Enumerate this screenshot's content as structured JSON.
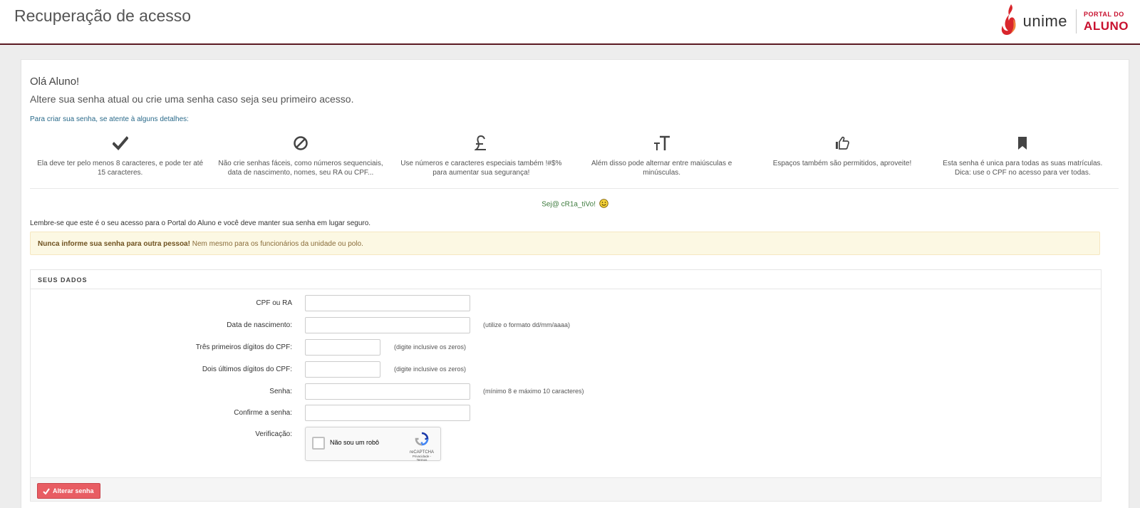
{
  "header": {
    "title": "Recuperação de acesso",
    "brand_name": "unime",
    "portal_line1": "PORTAL DO",
    "portal_line2": "ALUNO"
  },
  "intro": {
    "greeting": "Olá Aluno!",
    "subtitle": "Altere sua senha atual ou crie uma senha caso seja seu primeiro acesso.",
    "tips_lead": "Para criar sua senha, se atente à alguns detalhes:"
  },
  "rules": [
    {
      "icon": "check-icon",
      "text": "Ela deve ter pelo menos 8 caracteres, e pode ter até 15 caracteres."
    },
    {
      "icon": "ban-icon",
      "text": "Não crie senhas fáceis, como números sequenciais, data de nascimento, nomes, seu RA ou CPF..."
    },
    {
      "icon": "pound-icon",
      "text": "Use números e caracteres especiais também !#$% para aumentar sua segurança!"
    },
    {
      "icon": "text-size-icon",
      "text": "Além disso pode alternar entre maiúsculas e minúsculas."
    },
    {
      "icon": "thumbs-up-icon",
      "text": "Espaços também são permitidos, aproveite!"
    },
    {
      "icon": "bookmark-icon",
      "text": "Esta senha é unica para todas as suas matrículas. Dica: use o CPF no acesso para ver todas."
    }
  ],
  "motto": "Sej@ cR1a_tiVo!",
  "remember": "Lembre-se que este é o seu acesso para o Portal do Aluno e você deve manter sua senha em lugar seguro.",
  "warning": {
    "strong": "Nunca informe sua senha para outra pessoa!",
    "rest": " Nem mesmo para os funcionários da unidade ou polo."
  },
  "form": {
    "section_title": "SEUS DADOS",
    "cpf_ra": {
      "label": "CPF ou RA",
      "value": ""
    },
    "birth": {
      "label": "Data de nascimento:",
      "value": "",
      "hint": "(utilize o formato dd/mm/aaaa)"
    },
    "cpf_first": {
      "label": "Três primeiros dígitos do CPF:",
      "value": "",
      "hint": "(digite inclusive os zeros)"
    },
    "cpf_last": {
      "label": "Dois últimos dígitos do CPF:",
      "value": "",
      "hint": "(digite inclusive os zeros)"
    },
    "password": {
      "label": "Senha:",
      "value": "",
      "hint": "(mínimo 8 e máximo 10 caracteres)"
    },
    "password_confirm": {
      "label": "Confirme a senha:",
      "value": ""
    },
    "verification": {
      "label": "Verificação:",
      "captcha_label": "Não sou um robô",
      "captcha_brand": "reCAPTCHA",
      "captcha_links": "Privacidade - Termos"
    },
    "submit_label": "Alterar senha"
  },
  "colors": {
    "header_border": "#5b1a22",
    "brand_red": "#c8102e",
    "submit": "#e85d63",
    "warning_bg": "#fcf8e3"
  }
}
